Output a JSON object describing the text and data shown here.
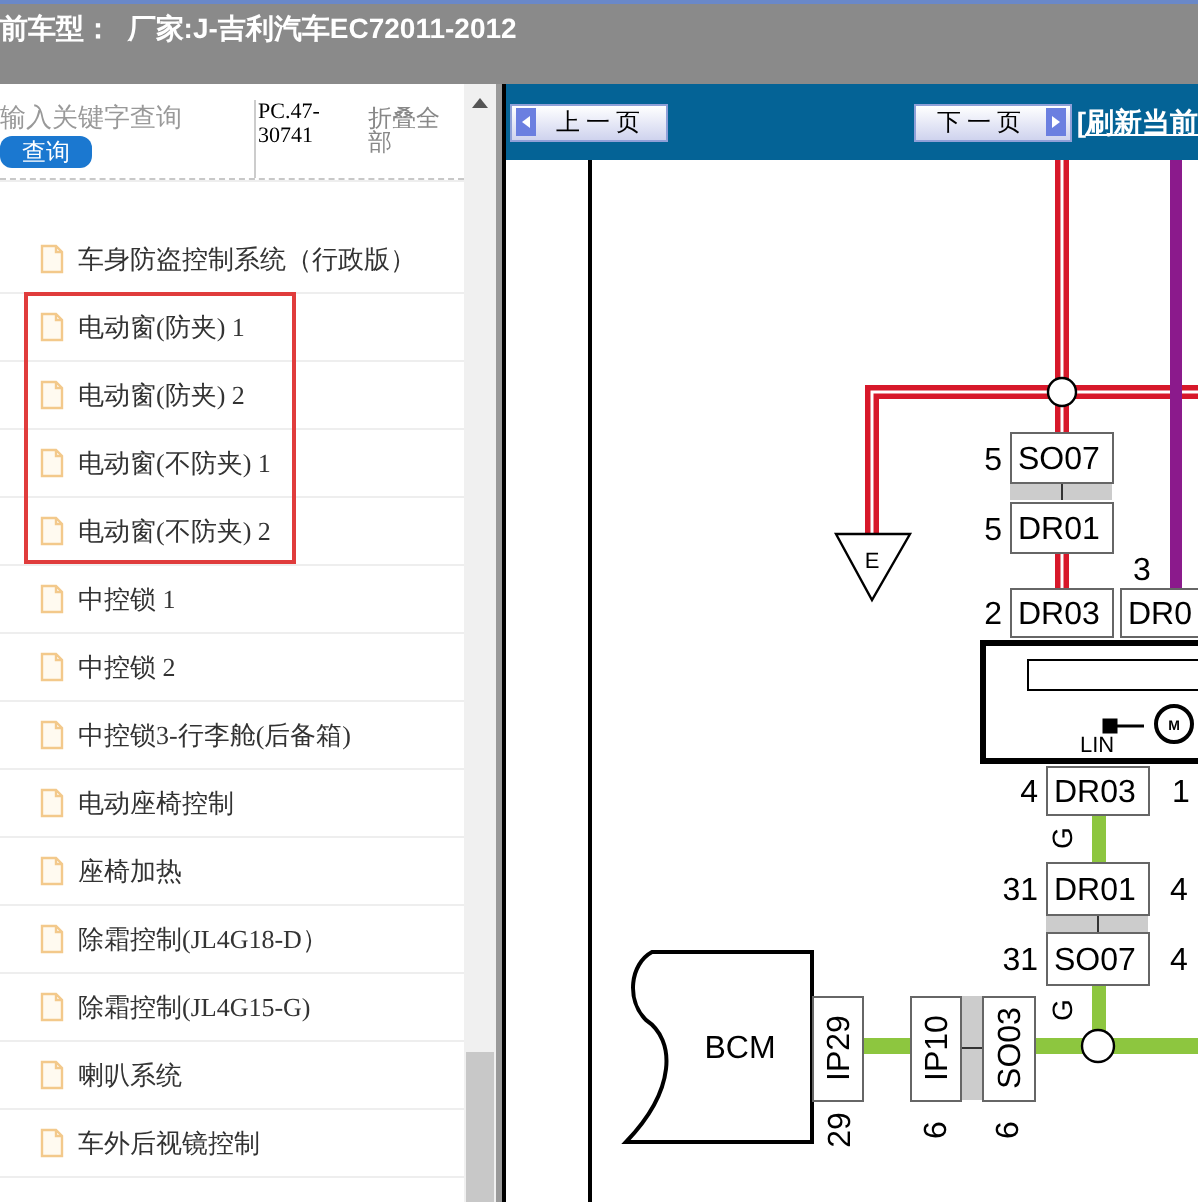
{
  "header": {
    "title": "前车型：  厂家:J-吉利汽车EC72011-2012"
  },
  "sidebar": {
    "search": {
      "placeholder": "输入关键字查询"
    },
    "search_button": "查询",
    "code": "PC.47-30741",
    "collapse_all": "折叠全部",
    "items": [
      {
        "label": "车身防盗控制系统（行政版）",
        "highlighted": false
      },
      {
        "label": "电动窗(防夹) 1",
        "highlighted": true
      },
      {
        "label": "电动窗(防夹) 2",
        "highlighted": true
      },
      {
        "label": "电动窗(不防夹) 1",
        "highlighted": true
      },
      {
        "label": "电动窗(不防夹) 2",
        "highlighted": true
      },
      {
        "label": "中控锁 1",
        "highlighted": false
      },
      {
        "label": "中控锁 2",
        "highlighted": false
      },
      {
        "label": "中控锁3-行李舱(后备箱)",
        "highlighted": false
      },
      {
        "label": "电动座椅控制",
        "highlighted": false
      },
      {
        "label": "座椅加热",
        "highlighted": false
      },
      {
        "label": "除霜控制(JL4G18-D）",
        "highlighted": false
      },
      {
        "label": "除霜控制(JL4G15-G)",
        "highlighted": false
      },
      {
        "label": "喇叭系统",
        "highlighted": false
      },
      {
        "label": "车外后视镜控制",
        "highlighted": false
      }
    ]
  },
  "toolbar": {
    "prev_button": "上一页",
    "next_button": "下一页",
    "refresh_link": "[刷新当前"
  },
  "diagram": {
    "ground": "E",
    "module": "BCM",
    "lin": "LIN",
    "motor": "M",
    "connectors": [
      {
        "name": "SO07",
        "pin": "5"
      },
      {
        "name": "DR01",
        "pin": "5"
      },
      {
        "name": "DR03",
        "pin": "2"
      },
      {
        "name": "DR0",
        "pin": "3"
      },
      {
        "name": "DR03",
        "pin": "4"
      },
      {
        "name": "DR01",
        "pin": "31"
      },
      {
        "name": "SO07",
        "pin": "31"
      },
      {
        "name": "IP29",
        "pin": "29"
      },
      {
        "name": "IP10",
        "pin": "6"
      },
      {
        "name": "SO03",
        "pin": "6"
      }
    ],
    "side_pins": [
      "1",
      "4",
      "4"
    ],
    "wire_labels": [
      "G",
      "G"
    ]
  }
}
